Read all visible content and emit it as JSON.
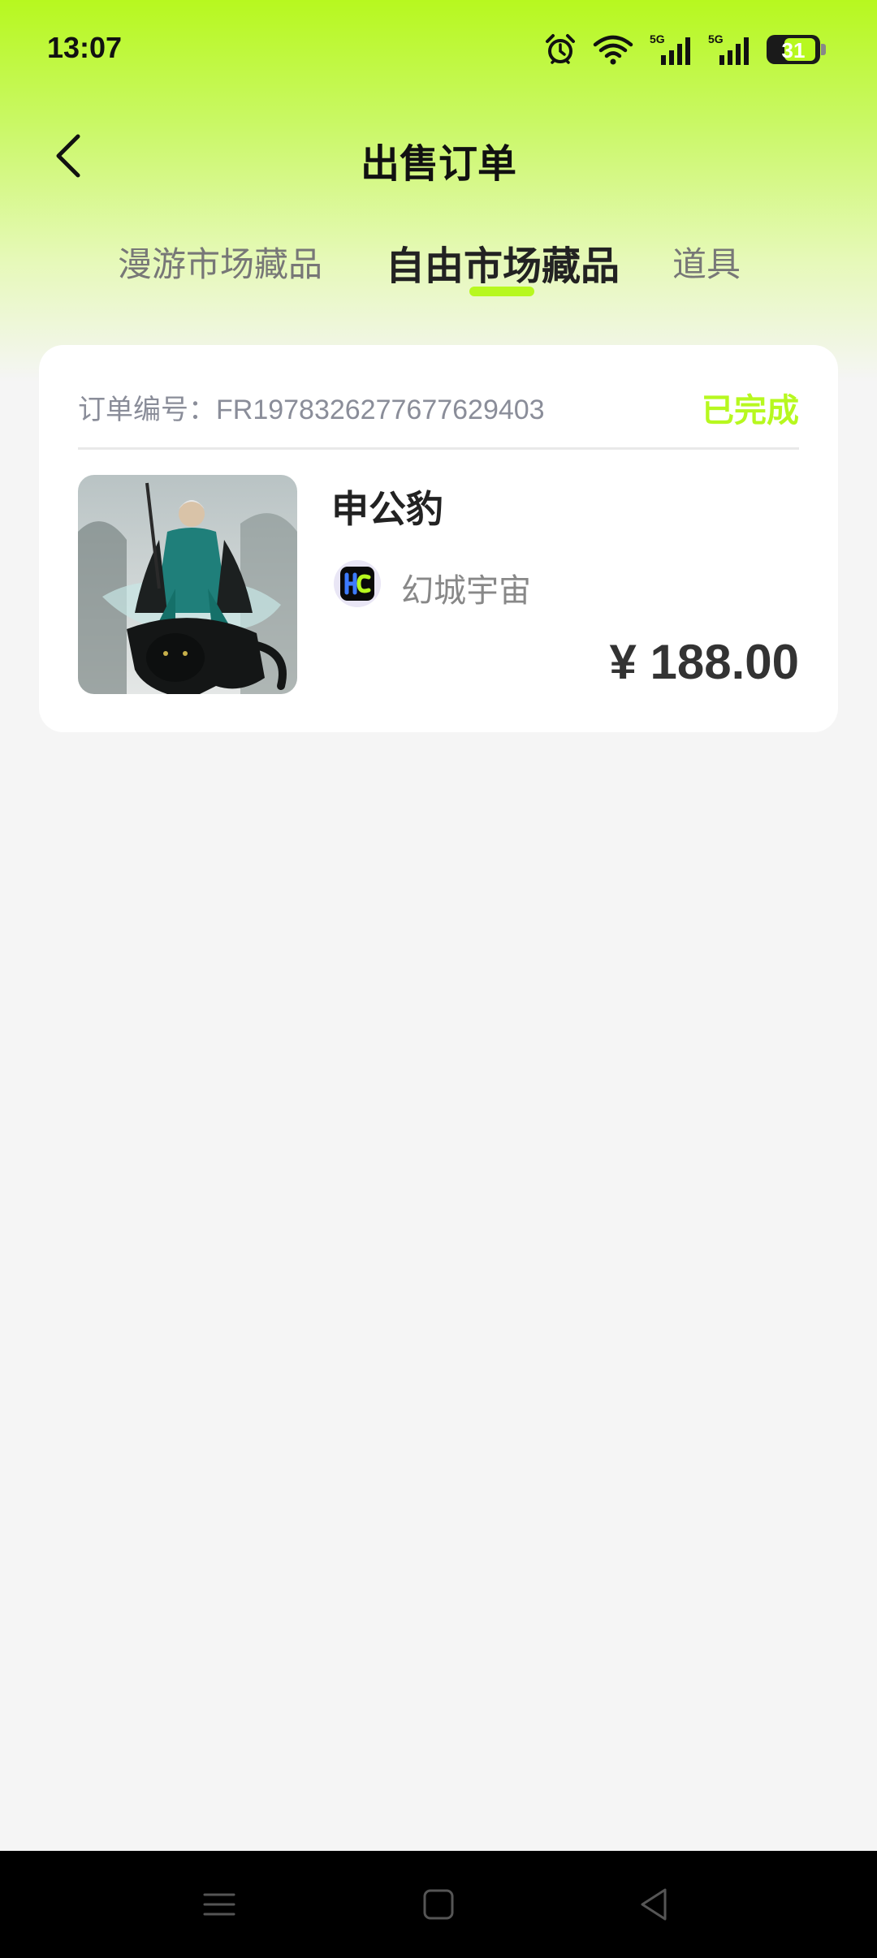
{
  "status_bar": {
    "time": "13:07",
    "icons": [
      "alarm-icon",
      "wifi-icon",
      "signal-5g-icon",
      "signal-5g-icon",
      "battery-icon"
    ],
    "network_label_1": "5G",
    "network_label_2": "5G",
    "battery": "31"
  },
  "nav": {
    "back_icon": "chevron-left-icon",
    "title": "出售订单"
  },
  "tabs": [
    {
      "label": "漫游市场藏品",
      "active": false
    },
    {
      "label": "自由市场藏品",
      "active": true
    },
    {
      "label": "道具",
      "active": false
    }
  ],
  "order": {
    "number": "订单编号：FR1978326277677629403",
    "status": "已完成",
    "item_name": "申公豹",
    "issuer_name": "幻城宇宙",
    "issuer_logo_text": "H",
    "price": "¥ 188.00"
  },
  "colors": {
    "accent": "#b7f81f",
    "background": "#f5f5f5",
    "card": "#ffffff",
    "navbar": "#000000"
  },
  "system_nav": [
    "menu-icon",
    "home-icon",
    "back-triangle-icon"
  ]
}
